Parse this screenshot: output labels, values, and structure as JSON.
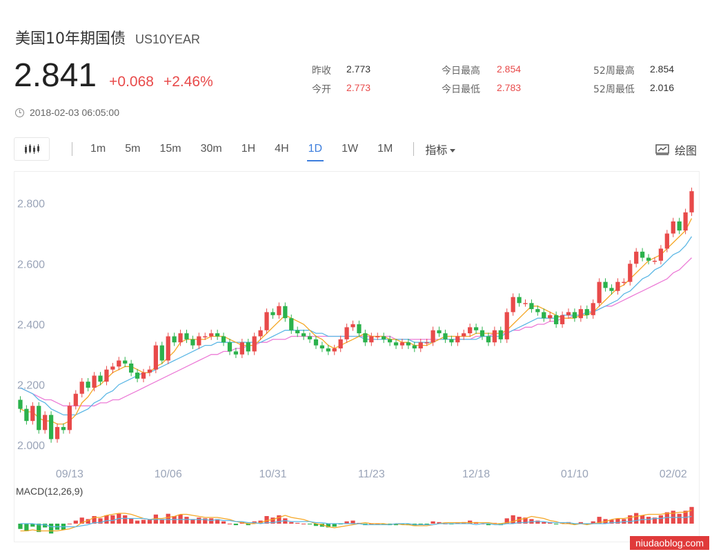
{
  "header": {
    "title": "美国10年期国债",
    "symbol": "US10YEAR",
    "price": "2.841",
    "change": "+0.068",
    "change_pct": "+2.46%",
    "timestamp": "2018-02-03 06:05:00"
  },
  "stats": [
    {
      "label": "昨收",
      "value": "2.773",
      "up": false
    },
    {
      "label": "今开",
      "value": "2.773",
      "up": true
    },
    {
      "label": "今日最高",
      "value": "2.854",
      "up": true
    },
    {
      "label": "今日最低",
      "value": "2.783",
      "up": true
    },
    {
      "label": "52周最高",
      "value": "2.854",
      "up": false
    },
    {
      "label": "52周最低",
      "value": "2.016",
      "up": false
    }
  ],
  "toolbar": {
    "chart_type_icon": "candlestick-icon",
    "timeframes": [
      "1m",
      "5m",
      "15m",
      "30m",
      "1H",
      "4H",
      "1D",
      "1W",
      "1M"
    ],
    "active_timeframe": "1D",
    "indicator_label": "指标",
    "draw_label": "绘图",
    "draw_icon": "drawing-icon"
  },
  "colors": {
    "up": "#e84a4a",
    "down": "#2bb24c",
    "ma_short": "#f5a623",
    "ma_mid": "#5bb7e5",
    "ma_long": "#ec7ad6",
    "accent": "#3b7ddd"
  },
  "watermark": "niudaoblog.com",
  "chart_data": {
    "type": "candlestick",
    "ylim": [
      1.98,
      2.87
    ],
    "y_ticks": [
      "2.800",
      "2.600",
      "2.400",
      "2.200",
      "2.000"
    ],
    "y_tick_values": [
      2.8,
      2.6,
      2.4,
      2.2,
      2.0
    ],
    "x_tick_labels": [
      "09/13",
      "10/06",
      "10/31",
      "11/23",
      "12/18",
      "01/10",
      "02/02"
    ],
    "x_tick_index": [
      8,
      24,
      41,
      57,
      74,
      90,
      106
    ],
    "closes": [
      2.12,
      2.08,
      2.13,
      2.05,
      2.1,
      2.02,
      2.06,
      2.05,
      2.13,
      2.17,
      2.21,
      2.19,
      2.23,
      2.21,
      2.25,
      2.26,
      2.28,
      2.27,
      2.24,
      2.22,
      2.24,
      2.25,
      2.33,
      2.28,
      2.36,
      2.34,
      2.37,
      2.35,
      2.33,
      2.36,
      2.36,
      2.37,
      2.36,
      2.34,
      2.31,
      2.3,
      2.34,
      2.31,
      2.36,
      2.38,
      2.44,
      2.43,
      2.46,
      2.42,
      2.38,
      2.37,
      2.36,
      2.35,
      2.33,
      2.32,
      2.31,
      2.32,
      2.35,
      2.39,
      2.4,
      2.37,
      2.34,
      2.36,
      2.36,
      2.35,
      2.34,
      2.33,
      2.34,
      2.33,
      2.32,
      2.34,
      2.34,
      2.38,
      2.37,
      2.35,
      2.34,
      2.36,
      2.37,
      2.39,
      2.38,
      2.36,
      2.34,
      2.38,
      2.35,
      2.44,
      2.49,
      2.47,
      2.47,
      2.45,
      2.44,
      2.42,
      2.43,
      2.4,
      2.43,
      2.44,
      2.42,
      2.45,
      2.43,
      2.47,
      2.54,
      2.52,
      2.51,
      2.54,
      2.54,
      2.6,
      2.64,
      2.62,
      2.61,
      2.61,
      2.65,
      2.7,
      2.74,
      2.71,
      2.77,
      2.84
    ],
    "opens": [
      2.15,
      2.12,
      2.08,
      2.13,
      2.05,
      2.1,
      2.02,
      2.06,
      2.05,
      2.13,
      2.17,
      2.21,
      2.19,
      2.23,
      2.21,
      2.25,
      2.26,
      2.28,
      2.27,
      2.24,
      2.22,
      2.24,
      2.25,
      2.33,
      2.28,
      2.36,
      2.34,
      2.37,
      2.35,
      2.33,
      2.36,
      2.36,
      2.37,
      2.36,
      2.34,
      2.31,
      2.3,
      2.34,
      2.31,
      2.36,
      2.38,
      2.44,
      2.43,
      2.46,
      2.42,
      2.38,
      2.37,
      2.36,
      2.35,
      2.33,
      2.32,
      2.31,
      2.32,
      2.35,
      2.39,
      2.4,
      2.37,
      2.34,
      2.36,
      2.36,
      2.35,
      2.34,
      2.33,
      2.34,
      2.33,
      2.32,
      2.34,
      2.34,
      2.38,
      2.37,
      2.35,
      2.34,
      2.36,
      2.37,
      2.39,
      2.38,
      2.36,
      2.34,
      2.38,
      2.35,
      2.44,
      2.49,
      2.47,
      2.47,
      2.45,
      2.44,
      2.42,
      2.43,
      2.4,
      2.43,
      2.44,
      2.42,
      2.45,
      2.43,
      2.47,
      2.54,
      2.52,
      2.51,
      2.54,
      2.54,
      2.6,
      2.64,
      2.62,
      2.61,
      2.61,
      2.65,
      2.7,
      2.74,
      2.71,
      2.77
    ],
    "ma_short": [
      2.12,
      2.11,
      2.11,
      2.09,
      2.08,
      2.08,
      2.07,
      2.07,
      2.08,
      2.1,
      2.14,
      2.16,
      2.19,
      2.2,
      2.22,
      2.24,
      2.25,
      2.26,
      2.26,
      2.25,
      2.24,
      2.24,
      2.26,
      2.27,
      2.29,
      2.31,
      2.34,
      2.35,
      2.35,
      2.35,
      2.35,
      2.36,
      2.36,
      2.36,
      2.35,
      2.34,
      2.33,
      2.33,
      2.33,
      2.35,
      2.37,
      2.39,
      2.41,
      2.43,
      2.42,
      2.41,
      2.4,
      2.38,
      2.36,
      2.35,
      2.33,
      2.32,
      2.33,
      2.34,
      2.35,
      2.36,
      2.37,
      2.36,
      2.36,
      2.36,
      2.35,
      2.35,
      2.34,
      2.34,
      2.33,
      2.33,
      2.33,
      2.34,
      2.35,
      2.36,
      2.36,
      2.36,
      2.36,
      2.36,
      2.37,
      2.37,
      2.37,
      2.37,
      2.37,
      2.38,
      2.4,
      2.42,
      2.44,
      2.46,
      2.46,
      2.45,
      2.44,
      2.43,
      2.42,
      2.42,
      2.42,
      2.43,
      2.43,
      2.44,
      2.46,
      2.48,
      2.5,
      2.52,
      2.53,
      2.55,
      2.57,
      2.59,
      2.61,
      2.62,
      2.63,
      2.65,
      2.67,
      2.69,
      2.71,
      2.75
    ],
    "ma_mid": [
      2.19,
      2.18,
      2.17,
      2.15,
      2.14,
      2.12,
      2.11,
      2.1,
      2.1,
      2.1,
      2.11,
      2.12,
      2.14,
      2.15,
      2.17,
      2.18,
      2.2,
      2.21,
      2.22,
      2.23,
      2.24,
      2.24,
      2.25,
      2.26,
      2.27,
      2.28,
      2.29,
      2.3,
      2.31,
      2.32,
      2.33,
      2.33,
      2.34,
      2.34,
      2.34,
      2.34,
      2.34,
      2.34,
      2.34,
      2.34,
      2.35,
      2.36,
      2.37,
      2.38,
      2.38,
      2.38,
      2.38,
      2.38,
      2.37,
      2.37,
      2.36,
      2.36,
      2.36,
      2.36,
      2.36,
      2.36,
      2.35,
      2.35,
      2.35,
      2.35,
      2.35,
      2.35,
      2.35,
      2.35,
      2.34,
      2.34,
      2.34,
      2.34,
      2.35,
      2.35,
      2.35,
      2.35,
      2.35,
      2.35,
      2.35,
      2.36,
      2.36,
      2.36,
      2.36,
      2.37,
      2.38,
      2.39,
      2.4,
      2.41,
      2.42,
      2.42,
      2.42,
      2.42,
      2.43,
      2.43,
      2.43,
      2.43,
      2.44,
      2.44,
      2.45,
      2.46,
      2.47,
      2.48,
      2.5,
      2.51,
      2.53,
      2.55,
      2.56,
      2.58,
      2.59,
      2.61,
      2.63,
      2.64,
      2.66,
      2.69
    ],
    "ma_long": [
      2.19,
      2.18,
      2.17,
      2.16,
      2.15,
      2.15,
      2.14,
      2.13,
      2.13,
      2.13,
      2.13,
      2.13,
      2.13,
      2.14,
      2.14,
      2.15,
      2.15,
      2.16,
      2.17,
      2.18,
      2.19,
      2.2,
      2.21,
      2.22,
      2.23,
      2.24,
      2.25,
      2.26,
      2.27,
      2.28,
      2.29,
      2.3,
      2.3,
      2.31,
      2.31,
      2.32,
      2.32,
      2.33,
      2.33,
      2.34,
      2.34,
      2.35,
      2.35,
      2.35,
      2.36,
      2.36,
      2.36,
      2.36,
      2.36,
      2.36,
      2.36,
      2.36,
      2.36,
      2.36,
      2.36,
      2.36,
      2.36,
      2.36,
      2.36,
      2.36,
      2.36,
      2.35,
      2.35,
      2.35,
      2.35,
      2.35,
      2.35,
      2.35,
      2.35,
      2.35,
      2.35,
      2.35,
      2.35,
      2.35,
      2.36,
      2.36,
      2.36,
      2.37,
      2.37,
      2.37,
      2.38,
      2.38,
      2.39,
      2.39,
      2.4,
      2.4,
      2.41,
      2.41,
      2.42,
      2.42,
      2.43,
      2.43,
      2.44,
      2.44,
      2.45,
      2.46,
      2.46,
      2.47,
      2.48,
      2.49,
      2.5,
      2.51,
      2.52,
      2.53,
      2.54,
      2.55,
      2.57,
      2.58,
      2.6,
      2.62
    ],
    "macd_label": "MACD(12,26,9)"
  }
}
